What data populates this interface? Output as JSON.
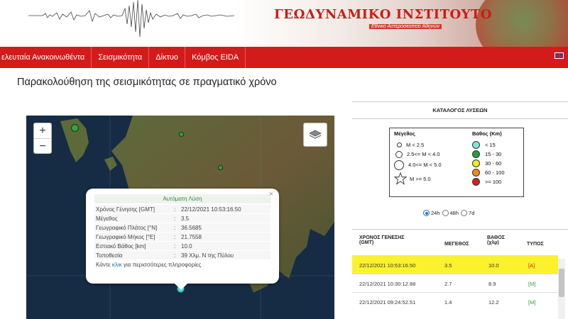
{
  "header": {
    "institute_title": "ΓΕΩΔΥΝΑΜΙΚΟ ΙΝΣΤΙΤΟΥΤΟ",
    "institute_subtitle": "Εθνικό Αστεροσκοπείο Αθηνών"
  },
  "nav": {
    "items": [
      "ελευταία Ανακοινωθέντα",
      "Σεισμικότητα",
      "Δίκτυο",
      "Κόμβος EIDA"
    ]
  },
  "page": {
    "title": "Παρακολούθηση της σεισμικότητας σε πραγματικό χρόνο"
  },
  "map": {
    "zoom_in": "+",
    "zoom_out": "−",
    "popup": {
      "close": "×",
      "heading": "Αυτόματη Λύση",
      "rows": [
        {
          "label": "Χρόνος Γένησης [GMT]",
          "value": "22/12/2021 10:53:16.50"
        },
        {
          "label": "Μέγεθος",
          "value": "3.5"
        },
        {
          "label": "Γεωγραφικό Πλάτος [°N]",
          "value": "36.5685"
        },
        {
          "label": "Γεωγραφικό Μήκος [°E]",
          "value": "21.7558"
        },
        {
          "label": "Εστιακό Βάθος [km]",
          "value": "10.0"
        },
        {
          "label": "Τοποθεσία",
          "value": "39 Χλμ. Ν της Πύλου"
        }
      ],
      "link_prefix": "Κάντε ",
      "link_text": "κλικ",
      "link_suffix": " για περισσότερες πληροφορίες"
    }
  },
  "panel": {
    "catalog_title": "ΚΑΤΑΛΟΓΟΣ ΛΥΣΕΩΝ",
    "legend": {
      "magnitude_heading": "Μέγεθος",
      "magnitudes": [
        "M < 2.5",
        "2.5<= M < 4.0",
        "4.0<= M < 5.0",
        "M >= 5.0"
      ],
      "depth_heading": "Βάθος (Km)",
      "depths": [
        {
          "label": "< 15",
          "color": "#7fe3e3"
        },
        {
          "label": "15 - 30",
          "color": "#2e9c3e"
        },
        {
          "label": "30 - 60",
          "color": "#f2ea2b"
        },
        {
          "label": "60 - 100",
          "color": "#f08a1c"
        },
        {
          "label": ">= 100",
          "color": "#d21e1e"
        }
      ]
    },
    "time_options": [
      {
        "label": "24h",
        "selected": true
      },
      {
        "label": "48h",
        "selected": false
      },
      {
        "label": "7d",
        "selected": false
      }
    ],
    "table": {
      "headers": {
        "time_line1": "ΧΡΟΝΟΣ ΓΕΝΕΣΗΣ",
        "time_line2": "(GMT)",
        "magnitude": "ΜΕΓΕΘΟΣ",
        "depth_line1": "ΒΑΘΟΣ",
        "depth_line2": "(χλμ)",
        "type": "ΤΥΠΟΣ"
      },
      "rows": [
        {
          "time": "22/12/2021 10:53:16.50",
          "magnitude": "3.5",
          "depth": "10.0",
          "type": "[A]",
          "highlight": true
        },
        {
          "time": "22/12/2021 10:30:12.88",
          "magnitude": "2.7",
          "depth": "8.9",
          "type": "[M]",
          "highlight": false
        },
        {
          "time": "22/12/2021 09:24:52.51",
          "magnitude": "1.4",
          "depth": "12.2",
          "type": "[M]",
          "highlight": false
        }
      ]
    }
  }
}
